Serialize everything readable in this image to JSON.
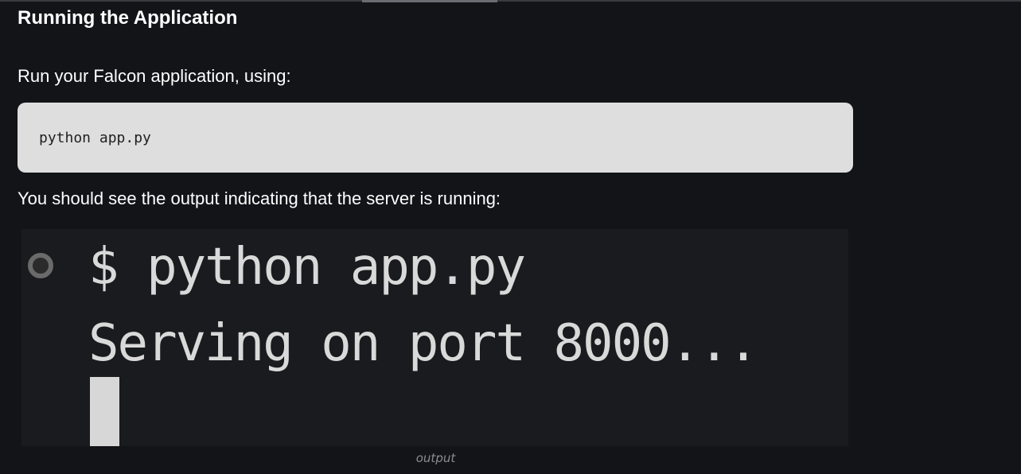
{
  "article": {
    "heading": "Running the Application",
    "intro_text": "Run your Falcon application, using:",
    "code_block": {
      "code": "python app.py"
    },
    "output_text": "You should see the output indicating that the server is running:",
    "output_image": {
      "command_line": "$ python app.py",
      "output_line": "Serving on port 8000...",
      "caption": "output"
    }
  },
  "colors": {
    "page_background": "#131418",
    "code_background": "#dedede",
    "terminal_background": "#1a1b1e",
    "caption_color": "#8c8c8c"
  }
}
